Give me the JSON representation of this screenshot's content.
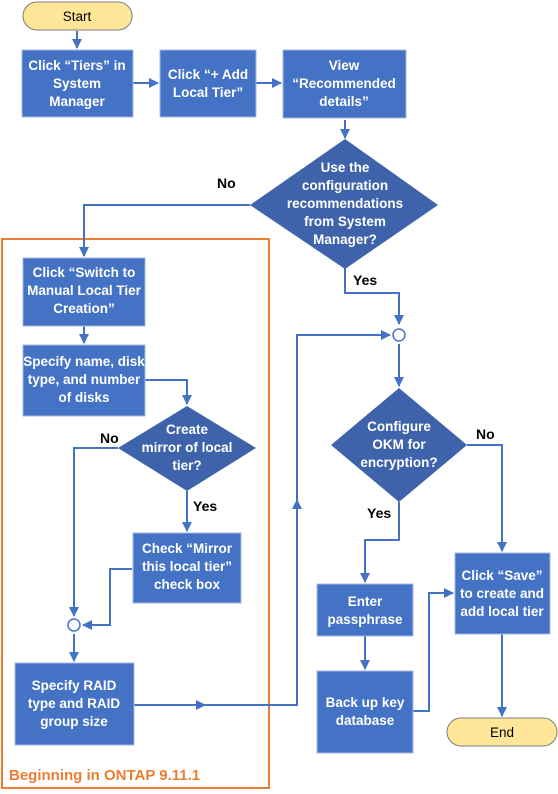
{
  "colors": {
    "process_fill": "#4472C4",
    "decision_fill": "#3F63AA",
    "terminal_fill": "#FFE699",
    "connector": "#4472C4",
    "region_border": "#ED7D31"
  },
  "nodes": {
    "start": {
      "lines": [
        "Start"
      ]
    },
    "click_tiers": {
      "lines": [
        "Click “Tiers” in",
        "System",
        "Manager"
      ]
    },
    "click_add": {
      "lines": [
        "Click “+ Add",
        "Local Tier”"
      ]
    },
    "view_recommended": {
      "lines": [
        "View",
        "“Recommended",
        "details”"
      ]
    },
    "use_config": {
      "lines": [
        "Use the",
        "configuration",
        "recommendations",
        "from System",
        "Manager?"
      ]
    },
    "switch_manual": {
      "lines": [
        "Click “Switch to",
        "Manual Local Tier",
        "Creation”"
      ]
    },
    "specify_name": {
      "lines": [
        "Specify name, disk",
        "type, and number",
        "of disks"
      ]
    },
    "create_mirror": {
      "lines": [
        "Create",
        "mirror of  local",
        "tier?"
      ]
    },
    "check_mirror": {
      "lines": [
        "Check “Mirror",
        "this local tier”",
        "check box"
      ]
    },
    "specify_raid": {
      "lines": [
        "Specify RAID",
        "type and RAID",
        "group size"
      ]
    },
    "configure_okm": {
      "lines": [
        "Configure",
        "OKM for",
        "encryption?"
      ]
    },
    "enter_passphrase": {
      "lines": [
        "Enter",
        "passphrase"
      ]
    },
    "backup_key": {
      "lines": [
        "Back up key",
        "database"
      ]
    },
    "click_save": {
      "lines": [
        "Click “Save”",
        "to create and",
        "add local tier"
      ]
    },
    "end": {
      "lines": [
        "End"
      ]
    }
  },
  "edge_labels": {
    "use_config_no": "No",
    "use_config_yes": "Yes",
    "mirror_no": "No",
    "mirror_yes": "Yes",
    "okm_no": "No",
    "okm_yes": "Yes"
  },
  "region": {
    "label": "Beginning in ONTAP 9.11.1"
  }
}
